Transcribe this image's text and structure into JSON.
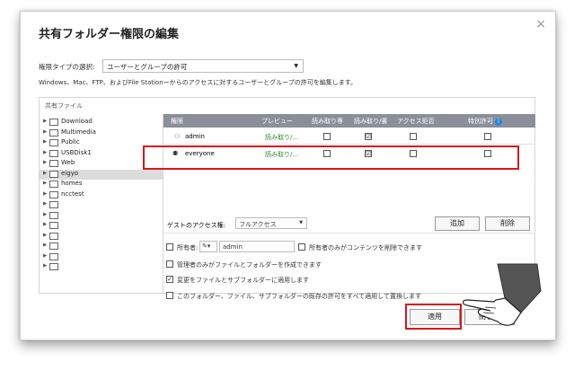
{
  "dialog": {
    "title": "共有フォルダー権限の編集",
    "close": "×"
  },
  "permission_type": {
    "label": "権限タイプの選択:",
    "value": "ユーザーとグループの許可"
  },
  "description": "Windows、Mac、FTP、およびFile Stationーからのアクセスに対するユーザーとグループの許可を編集します。",
  "panel": {
    "title": "共有ファイル",
    "tree": [
      "Download",
      "Multimedia",
      "Public",
      "USBDisk1",
      "Web",
      "eigyo",
      "homes",
      "ncctest",
      "",
      "",
      "",
      "",
      "",
      "",
      ""
    ],
    "selected_index": 5
  },
  "grid": {
    "headers": {
      "perm": "権限",
      "preview": "プレビュー",
      "ro": "読み取り専",
      "rw": "読み取り/書",
      "deny": "アクセス拒否",
      "special": "特別許可"
    },
    "rows": [
      {
        "user": "admin",
        "preview": "読み取り/...",
        "ro": "",
        "rw": "☑",
        "deny": "",
        "special": ""
      },
      {
        "user": "everyone",
        "preview": "読み取り/...",
        "ro": "",
        "rw": "☑",
        "deny": "",
        "special": ""
      }
    ]
  },
  "guest": {
    "label": "ゲストのアクセス権:",
    "value": "フルアクセス"
  },
  "buttons": {
    "add": "追加",
    "remove": "削除",
    "apply": "適用",
    "close": "閉じる"
  },
  "options": {
    "owner_label": "所有者:",
    "owner_value": "admin",
    "owner_only_delete": "所有者のみがコンテンツを削除できます",
    "admin_only_create": "管理者のみがファイルとフォルダーを作成できます",
    "apply_subfolders": "変更をファイルとサブフォルダーに適用します",
    "replace_all": "このフォルダー、ファイル、サブフォルダーの既存の許可をすべて適用して置換します"
  },
  "colors": {
    "highlight": "#d9161a",
    "header_bg": "#8a8f99",
    "preview_text": "#2f8a2f"
  }
}
